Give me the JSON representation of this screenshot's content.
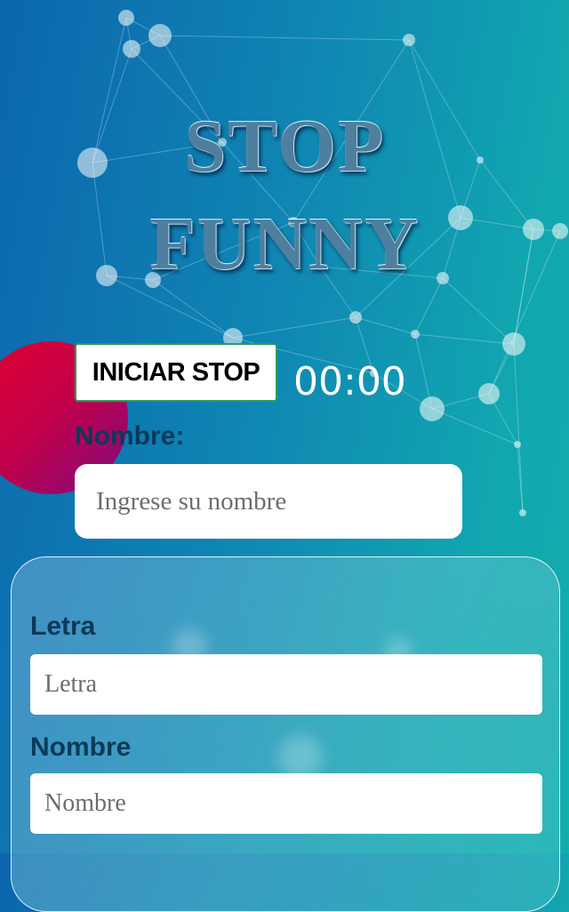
{
  "header": {
    "title_line1": "STOP",
    "title_line2": "FUNNY"
  },
  "game": {
    "start_button_label": "INICIAR STOP",
    "timer": "00:00"
  },
  "player": {
    "label": "Nombre:",
    "placeholder": "Ingrese su nombre"
  },
  "form": {
    "fields": [
      {
        "label": "Letra",
        "placeholder": "Letra"
      },
      {
        "label": "Nombre",
        "placeholder": "Nombre"
      }
    ]
  },
  "colors": {
    "background_start": "#0c66ad",
    "background_end": "#12aeae",
    "title": "#4f7f9e",
    "label": "#0b3a57",
    "button_border": "#2e9c5a",
    "circle_start": "#e0002e",
    "circle_end": "#7e0c80"
  }
}
